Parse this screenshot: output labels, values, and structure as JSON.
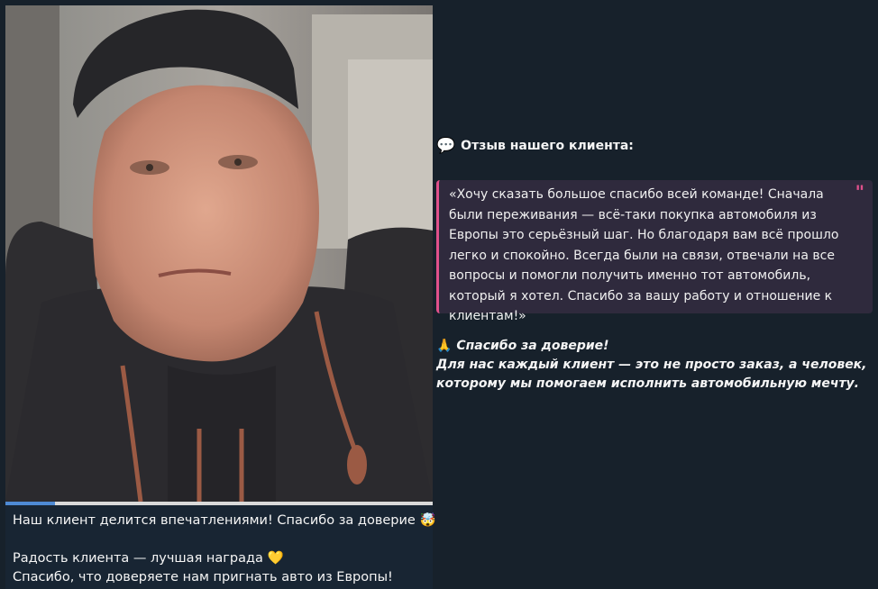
{
  "video": {
    "progress": 0.115
  },
  "caption": {
    "line1": "Наш клиент делится впечатлениями! Спасибо за доверие",
    "line1_emoji": "🤯",
    "line2": "Радость клиента — лучшая награда",
    "line2_emoji": "💛",
    "line3": "Спасибо, что доверяете нам пригнать авто из Европы!"
  },
  "review": {
    "heading_icon": "💬",
    "heading": "Отзыв нашего клиента:",
    "quote": "«Хочу сказать большое спасибо всей команде! Сначала были переживания — всё-таки покупка автомобиля из Европы это серьёзный шаг. Но благодаря вам всё прошло легко и спокойно. Всегда были на связи, отвечали на все вопросы и помогли получить именно тот автомобиль, который я хотел. Спасибо за вашу работу и отношение к клиентам!»",
    "quote_mark": "\"",
    "accent_color": "#e0508b"
  },
  "thanks": {
    "icon": "🙏",
    "title": "Спасибо за доверие!",
    "body": "Для нас каждый клиент — это не просто заказ, а человек, которому мы помогаем исполнить автомобильную мечту."
  }
}
